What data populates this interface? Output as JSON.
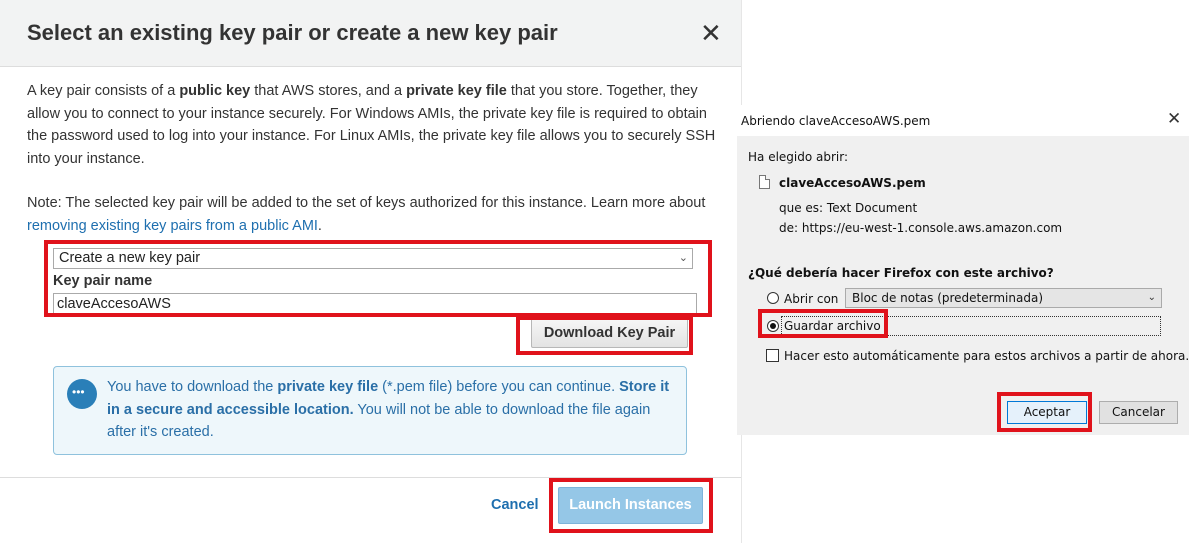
{
  "aws_modal": {
    "title": "Select an existing key pair or create a new key pair",
    "close_glyph": "✕",
    "paragraph1": {
      "t1": "A key pair consists of a ",
      "b1": "public key",
      "t2": " that AWS stores, and a ",
      "b2": "private key file",
      "t3": " that you store. Together, they allow you to connect to your instance securely. For Windows AMIs, the private key file is required to obtain the password used to log into your instance. For Linux AMIs, the private key file allows you to securely SSH into your instance."
    },
    "paragraph2": {
      "t1": "Note: The selected key pair will be added to the set of keys authorized for this instance. Learn more about ",
      "link": "removing existing key pairs from a public AMI",
      "t2": "."
    },
    "key_pair_select": "Create a new key pair",
    "key_pair_name_label": "Key pair name",
    "key_pair_name_value": "claveAccesoAWS",
    "download_button": "Download Key Pair",
    "info": {
      "t1": "You have to download the ",
      "b1": "private key file",
      "t2": " (*.pem file) before you can continue. ",
      "b2": "Store it in a secure and accessible location.",
      "t3": " You will not be able to download the file again after it's created."
    },
    "cancel_label": "Cancel",
    "launch_button": "Launch Instances"
  },
  "firefox_dialog": {
    "title": "Abriendo claveAccesoAWS.pem",
    "close_glyph": "✕",
    "chosen_label": "Ha elegido abrir:",
    "filename": "claveAccesoAWS.pem",
    "type_line": "que es:  Text Document",
    "from_line": "de:  https://eu-west-1.console.aws.amazon.com",
    "question": "¿Qué debería hacer Firefox con este archivo?",
    "open_with_label": "Abrir con",
    "open_with_app": "Bloc de notas (predeterminada)",
    "save_file_label": "Guardar archivo",
    "auto_label": "Hacer esto automáticamente para estos archivos a partir de ahora.",
    "accept_button": "Aceptar",
    "cancel_button": "Cancelar",
    "selected_option": "Guardar archivo"
  },
  "highlight_color": "#e0121b"
}
